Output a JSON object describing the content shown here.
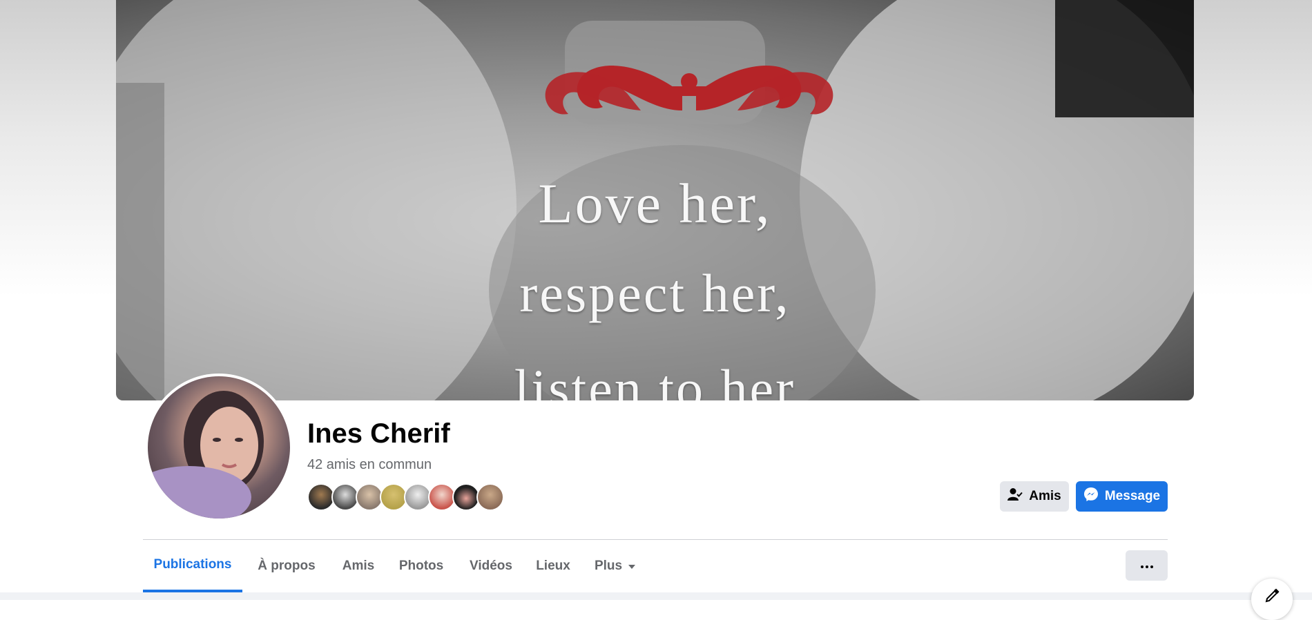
{
  "cover": {
    "lines": [
      "Love her,",
      "respect her,",
      "listen to her"
    ]
  },
  "profile": {
    "name": "Ines Cherif",
    "mutual_friends": "42 amis en commun",
    "mutual_avatar_colors": [
      "#2b2b2b",
      "#4a4a4a",
      "#8a7a6e",
      "#b5a24a",
      "#9a9a9a",
      "#c9544b",
      "#202020",
      "#8c6c58"
    ]
  },
  "actions": {
    "friends_label": "Amis",
    "message_label": "Message"
  },
  "tabs": [
    {
      "label": "Publications"
    },
    {
      "label": "À propos"
    },
    {
      "label": "Amis"
    },
    {
      "label": "Photos"
    },
    {
      "label": "Vidéos"
    },
    {
      "label": "Lieux"
    },
    {
      "label": "Plus"
    }
  ],
  "colors": {
    "accent": "#1b74e4",
    "ornament": "#b52428",
    "secondary_button": "#e4e6eb"
  }
}
